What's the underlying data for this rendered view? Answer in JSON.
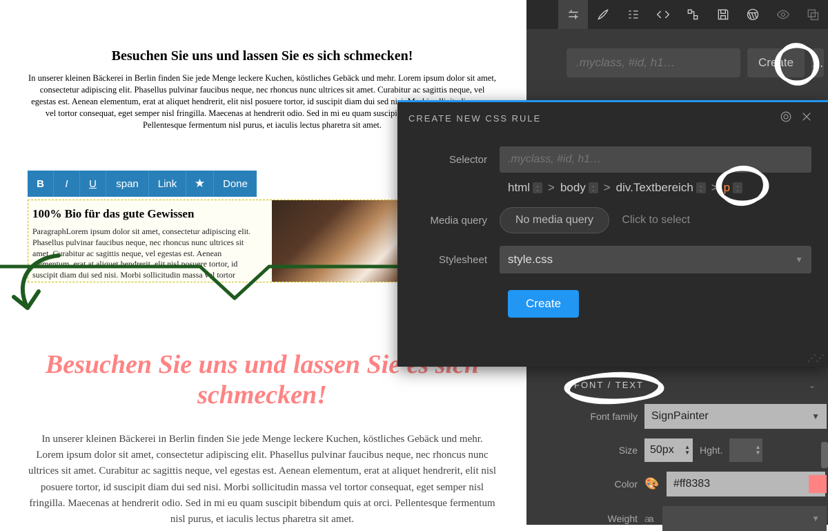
{
  "canvas": {
    "heading1": "Besuchen Sie uns und lassen Sie es sich schmecken!",
    "para1": "In unserer kleinen Bäckerei in Berlin finden Sie jede Menge leckere Kuchen, köstliches Gebäck und mehr.  Lorem ipsum dolor sit amet, consectetur adipiscing elit. Phasellus pulvinar faucibus neque, nec rhoncus nunc ultrices sit amet. Curabitur ac sagittis neque, vel egestas est. Aenean elementum, erat at aliquet hendrerit, elit nisl posuere tortor, id suscipit diam dui sed nisi. Morbi sollicitudin massa vel tortor consequat, eget semper nisl fringilla. Maecenas at hendrerit odio. Sed in mi eu quam suscipit bibendum quis at orci. Pellentesque fermentum nisl purus, et iaculis lectus pharetra sit amet.",
    "toolbar": {
      "b": "B",
      "i": "I",
      "u": "U",
      "span": "span",
      "link": "Link",
      "star": "★",
      "done": "Done"
    },
    "box": {
      "heading": "100% Bio für das gute Gewissen",
      "para": "ParagraphLorem ipsum dolor sit amet, consectetur adipiscing elit. Phasellus pulvinar faucibus neque, nec rhoncus nunc ultrices sit amet. Curabitur ac sagittis neque, vel egestas est. Aenean elementum, erat at aliquet hendrerit, elit nisl posuere tortor, id suscipit diam dui sed nisi. Morbi sollicitudin massa vel tortor consequat, eget semper nisl fringilla. Maecenas at hendrerit odio."
    },
    "styled_heading": "Besuchen Sie uns und lassen Sie es sich schmecken!",
    "para2": "In unserer kleinen Bäckerei in Berlin finden Sie jede Menge leckere Kuchen, köstliches Gebäck und mehr. Lorem ipsum dolor sit amet, consectetur adipiscing elit. Phasellus pulvinar faucibus neque, nec rhoncus nunc ultrices sit amet. Curabitur ac sagittis neque, vel egestas est. Aenean elementum, erat at aliquet hendrerit, elit nisl posuere tortor, id suscipit diam dui sed nisi. Morbi sollicitudin massa vel tortor consequat, eget semper nisl fringilla. Maecenas at hendrerit odio. Sed in mi eu quam suscipit bibendum quis at orci. Pellentesque fermentum nisl purus, et iaculis lectus pharetra sit amet."
  },
  "panel": {
    "selector_placeholder": ".myclass, #id, h1…",
    "create_btn": "Create",
    "more_btn": "…"
  },
  "dialog": {
    "title": "CREATE NEW CSS RULE",
    "labels": {
      "selector": "Selector",
      "media": "Media query",
      "stylesheet": "Stylesheet"
    },
    "selector_placeholder": ".myclass, #id, h1…",
    "crumbs": {
      "html": "html",
      "body": "body",
      "div": "div.Textbereich",
      "p": "p",
      "vd": ":"
    },
    "no_media": "No media query",
    "click_select": "Click to select",
    "stylesheet_value": "style.css",
    "create": "Create"
  },
  "font": {
    "section": "FONT / TEXT",
    "family_label": "Font family",
    "family_value": "SignPainter",
    "size_label": "Size",
    "size_value": "50px",
    "height_label": "Hght.",
    "color_label": "Color",
    "color_value": "#ff8383",
    "weight_label": "Weight"
  },
  "colors": {
    "accent": "#ff8383",
    "link": "#2196f3",
    "annotation": "#1f5a1f"
  }
}
